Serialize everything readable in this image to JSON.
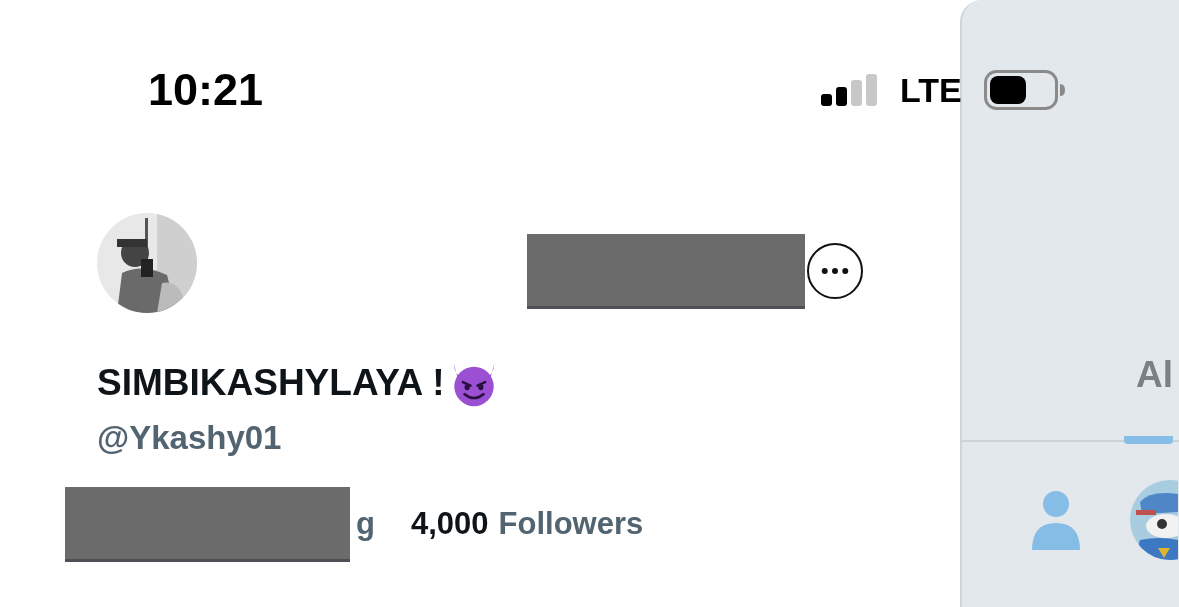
{
  "status_bar": {
    "time": "10:21",
    "network": "LTE"
  },
  "profile": {
    "display_name": "SIMBIKASHYLAYA !",
    "handle": "@Ykashy01",
    "following_label": "g",
    "followers_count": "4,000",
    "followers_label": "Followers"
  },
  "side_panel": {
    "tabs": [
      {
        "label": "Al",
        "selected": true
      }
    ]
  }
}
